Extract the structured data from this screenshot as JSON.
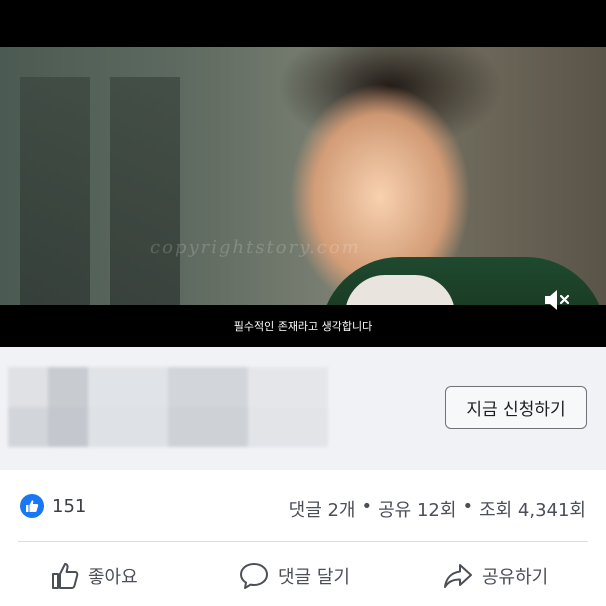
{
  "video": {
    "subtitle": "필수적인 존재라고 생각합니다",
    "watermark": "copyrightstory.com",
    "mute_icon": "speaker-muted-icon"
  },
  "ad": {
    "cta_label": "지금 신청하기"
  },
  "stats": {
    "like_icon": "thumbs-up-badge-icon",
    "likes": "151",
    "comments": "댓글 2개",
    "separator": "•",
    "shares": "공유 12회",
    "views": "조회 4,341회"
  },
  "actions": {
    "like_label": "좋아요",
    "comment_label": "댓글 달기",
    "share_label": "공유하기"
  },
  "colors": {
    "accent": "#1877f2",
    "panel": "#f0f2f5",
    "text_secondary": "#4b4f56"
  }
}
